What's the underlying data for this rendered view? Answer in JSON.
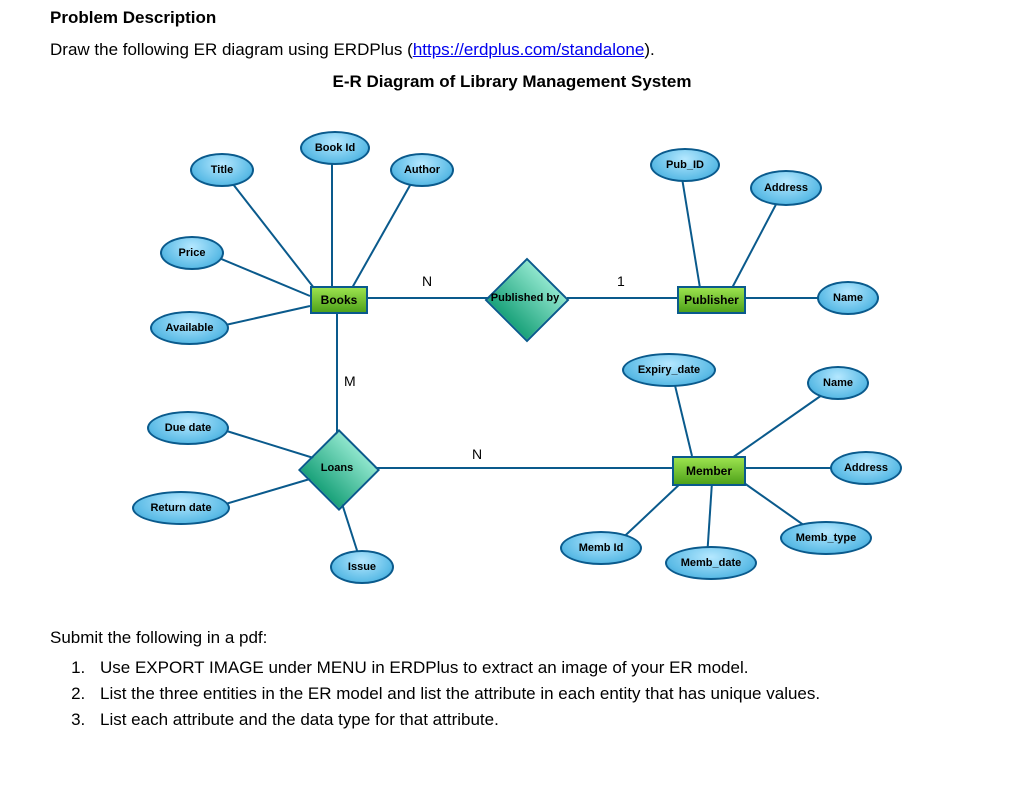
{
  "heading": "Problem Description",
  "intro_pre": "Draw the following ER diagram using ERDPlus (",
  "intro_link": "https://erdplus.com/standalone",
  "intro_post": ").",
  "diagram_title": "E-R Diagram of Library Management System",
  "entities": {
    "books": "Books",
    "publisher": "Publisher",
    "member": "Member"
  },
  "relationships": {
    "published_by": "Published by",
    "loans": "Loans"
  },
  "attributes": {
    "book_id": "Book Id",
    "title": "Title",
    "author": "Author",
    "price": "Price",
    "available": "Available",
    "pub_id": "Pub_ID",
    "address_pub": "Address",
    "name_pub": "Name",
    "expiry_date": "Expiry_date",
    "name_mem": "Name",
    "address_mem": "Address",
    "memb_type": "Memb_type",
    "memb_date": "Memb_date",
    "memb_id": "Memb Id",
    "issue": "Issue",
    "due_date": "Due date",
    "return_date": "Return date"
  },
  "cardinalities": {
    "books_published": "N",
    "publisher_published": "1",
    "books_loans": "M",
    "member_loans": "N"
  },
  "submit_intro": "Submit the following in a pdf:",
  "instructions": [
    "Use EXPORT IMAGE under MENU in ERDPlus to extract an image of your ER model.",
    "List the three entities in the ER model and list the attribute in each entity that has unique values.",
    "List each attribute and the data type for that attribute."
  ],
  "chart_data": {
    "type": "diagram",
    "diagram_type": "ER",
    "title": "E-R Diagram of Library Management System",
    "entities": [
      {
        "name": "Books",
        "attributes": [
          "Book Id",
          "Title",
          "Author",
          "Price",
          "Available"
        ]
      },
      {
        "name": "Publisher",
        "attributes": [
          "Pub_ID",
          "Address",
          "Name"
        ]
      },
      {
        "name": "Member",
        "attributes": [
          "Expiry_date",
          "Name",
          "Address",
          "Memb_type",
          "Memb_date",
          "Memb Id"
        ]
      }
    ],
    "relationships": [
      {
        "name": "Published by",
        "between": [
          "Books",
          "Publisher"
        ],
        "cardinality": [
          "N",
          "1"
        ]
      },
      {
        "name": "Loans",
        "between": [
          "Books",
          "Member"
        ],
        "cardinality": [
          "M",
          "N"
        ],
        "attributes": [
          "Issue",
          "Due date",
          "Return date"
        ]
      }
    ]
  }
}
